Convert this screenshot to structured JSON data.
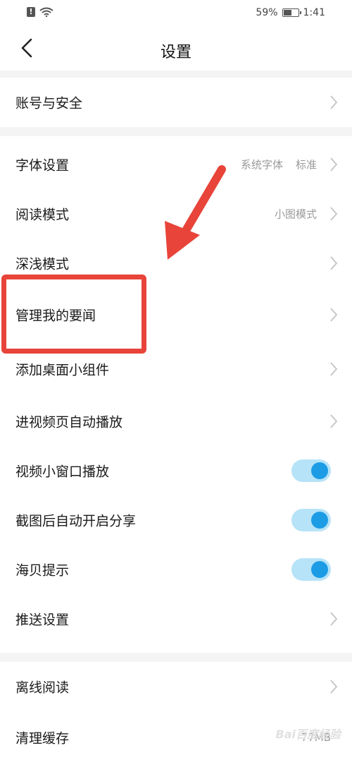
{
  "status_bar": {
    "battery_percent_text": "59%",
    "battery_level": 0.59,
    "time": "1:41",
    "icons": [
      "alert-icon",
      "wifi-icon",
      "battery-icon"
    ]
  },
  "header": {
    "title": "设置",
    "back_icon": "chevron-left-icon"
  },
  "sections": {
    "account": {
      "items": [
        {
          "label": "账号与安全"
        }
      ]
    },
    "display": {
      "items": [
        {
          "label": "字体设置",
          "value_font": "系统字体",
          "value_size": "标准"
        },
        {
          "label": "阅读模式",
          "value": "小图模式"
        },
        {
          "label": "深浅模式"
        },
        {
          "label": "管理我的要闻"
        },
        {
          "label": "添加桌面小组件"
        },
        {
          "label": "进视频页自动播放"
        },
        {
          "label": "视频小窗口播放",
          "toggle_on": true
        },
        {
          "label": "截图后自动开启分享",
          "toggle_on": true
        },
        {
          "label": "海贝提示",
          "toggle_on": true
        },
        {
          "label": "推送设置"
        }
      ]
    },
    "storage": {
      "items": [
        {
          "label": "离线阅读"
        },
        {
          "label": "清理缓存",
          "value": "77MB"
        }
      ]
    }
  },
  "annotations": {
    "highlight_color": "#e8443a",
    "arrow_color": "#e8443a"
  },
  "watermark": {
    "text": "Bai百度经验"
  },
  "colors": {
    "accent": "#1d9ce6",
    "toggle_track": "#b6e3f8",
    "background": "#f4f4f4"
  }
}
